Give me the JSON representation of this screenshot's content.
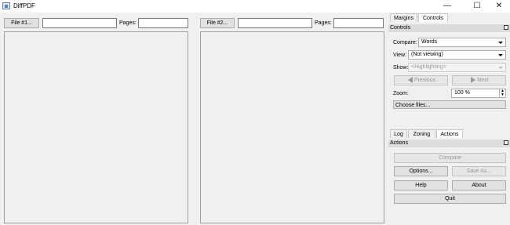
{
  "window": {
    "title": "DiffPDF"
  },
  "left_file": {
    "button_label": "File #1...",
    "path_value": "",
    "pages_label": "Pages:",
    "pages_value": ""
  },
  "right_file": {
    "button_label": "File #2...",
    "path_value": "",
    "pages_label": "Pages:",
    "pages_value": ""
  },
  "dock_top": {
    "tabs": [
      "Margins",
      "Controls"
    ],
    "active_tab": "Controls",
    "header": "Controls",
    "compare_label": "Compare:",
    "compare_value": "Words",
    "view_label": "View:",
    "view_value": "(Not viewing)",
    "show_label": "Show:",
    "show_value": "<Highlighting>",
    "previous_label": "Previous",
    "next_label": "Next",
    "zoom_label": "Zoom:",
    "zoom_value": "100 %",
    "choose_files_label": "Choose files..."
  },
  "dock_bottom": {
    "tabs": [
      "Log",
      "Zoning",
      "Actions"
    ],
    "active_tab": "Actions",
    "header": "Actions",
    "compare_label": "Compare",
    "options_label": "Options...",
    "save_as_label": "Save As...",
    "help_label": "Help",
    "about_label": "About",
    "quit_label": "Quit"
  }
}
